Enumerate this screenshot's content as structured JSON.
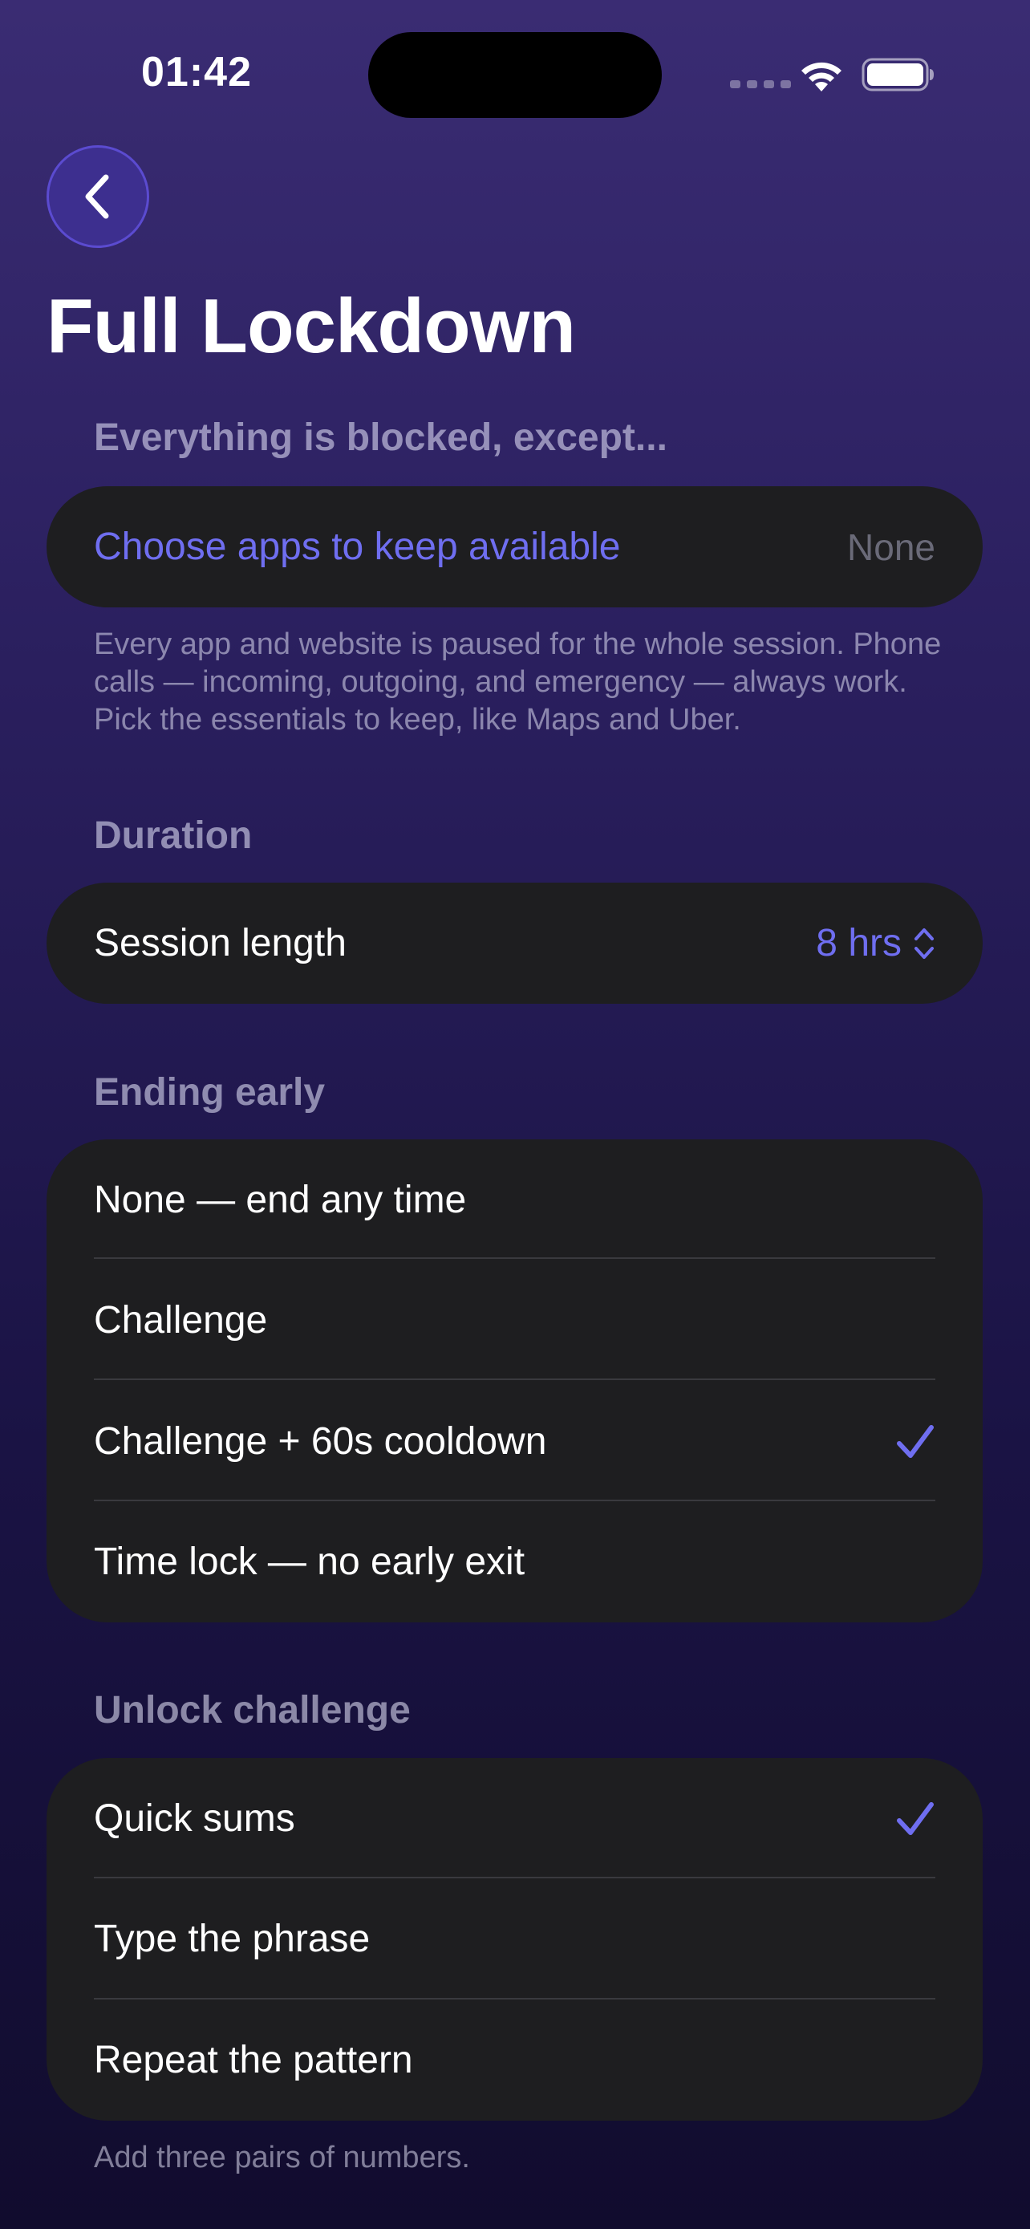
{
  "status_bar": {
    "time": "01:42"
  },
  "header": {
    "title": "Full Lockdown"
  },
  "blocked_section": {
    "header": "Everything is blocked, except...",
    "choose_label": "Choose apps to keep available",
    "choose_value": "None",
    "footnote": "Every app and website is paused for the whole session. Phone calls — incoming, outgoing, and emergency — always work. Pick the essentials to keep, like Maps and Uber."
  },
  "duration_section": {
    "header": "Duration",
    "label": "Session length",
    "value": "8 hrs"
  },
  "ending_section": {
    "header": "Ending early",
    "options": [
      {
        "label": "None — end any time",
        "selected": false
      },
      {
        "label": "Challenge",
        "selected": false
      },
      {
        "label": "Challenge + 60s cooldown",
        "selected": true
      },
      {
        "label": "Time lock — no early exit",
        "selected": false
      }
    ]
  },
  "challenge_section": {
    "header": "Unlock challenge",
    "options": [
      {
        "label": "Quick sums",
        "selected": true
      },
      {
        "label": "Type the phrase",
        "selected": false
      },
      {
        "label": "Repeat the pattern",
        "selected": false
      }
    ],
    "footnote": "Add three pairs of numbers."
  },
  "colors": {
    "accent": "#6f6ef0",
    "card": "#1e1e20"
  },
  "icons": [
    "back-chevron-icon",
    "wifi-icon",
    "battery-icon",
    "checkmark-icon",
    "stepper-chevrons-icon"
  ]
}
